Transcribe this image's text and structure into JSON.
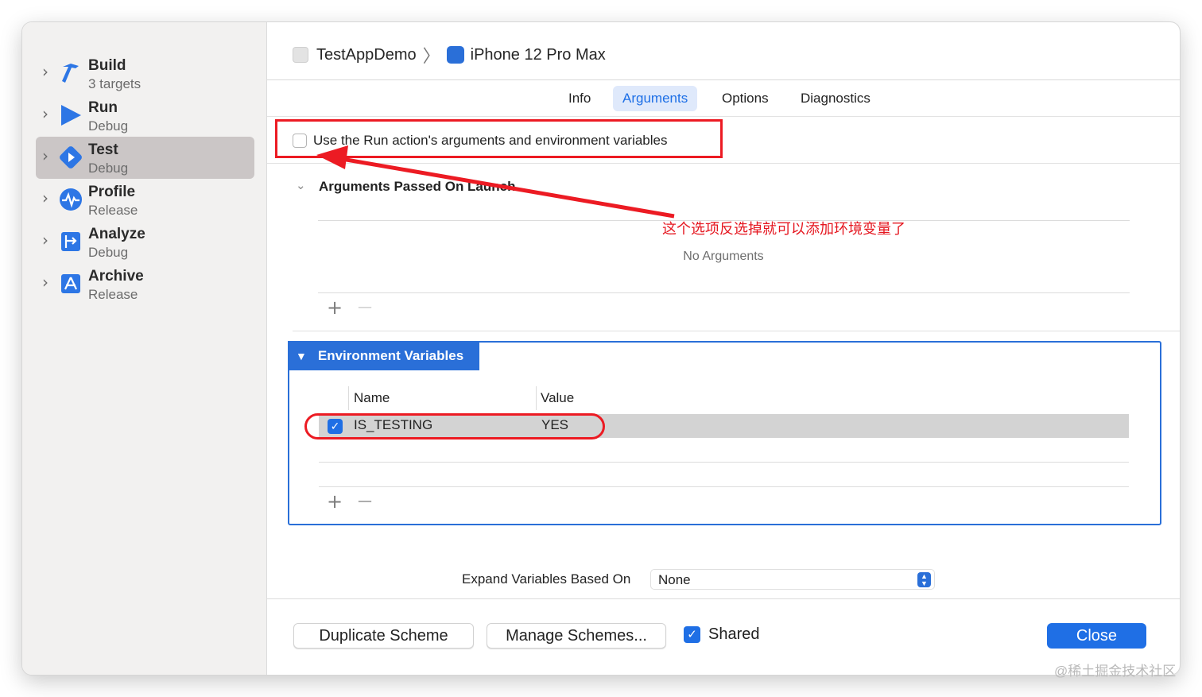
{
  "breadcrumb": {
    "project": "TestAppDemo",
    "separator": "〉",
    "device": "iPhone 12 Pro Max"
  },
  "sidebar": {
    "actions": [
      {
        "name": "Build",
        "sub": "3 targets",
        "icon": "hammer-icon",
        "selected": false
      },
      {
        "name": "Run",
        "sub": "Debug",
        "icon": "play-icon",
        "selected": false
      },
      {
        "name": "Test",
        "sub": "Debug",
        "icon": "test-diamond-icon",
        "selected": true
      },
      {
        "name": "Profile",
        "sub": "Release",
        "icon": "profile-waveform-icon",
        "selected": false
      },
      {
        "name": "Analyze",
        "sub": "Debug",
        "icon": "analyze-icon",
        "selected": false
      },
      {
        "name": "Archive",
        "sub": "Release",
        "icon": "archive-appstore-icon",
        "selected": false
      }
    ]
  },
  "tabs": [
    {
      "label": "Info",
      "active": false
    },
    {
      "label": "Arguments",
      "active": true
    },
    {
      "label": "Options",
      "active": false
    },
    {
      "label": "Diagnostics",
      "active": false
    }
  ],
  "run_action_option": {
    "label": "Use the Run action's arguments and environment variables",
    "checked": false
  },
  "arguments_section": {
    "title": "Arguments Passed On Launch",
    "empty_text": "No Arguments",
    "add": "+",
    "remove": "—"
  },
  "annotation": {
    "text": "这个选项反选掉就可以添加环境变量了",
    "color": "#e5161f"
  },
  "env_section": {
    "title": "Environment Variables",
    "columns": [
      "Name",
      "Value"
    ],
    "rows": [
      {
        "enabled": true,
        "name": "IS_TESTING",
        "value": "YES"
      }
    ],
    "add": "+",
    "remove": "—"
  },
  "expand_variables": {
    "label": "Expand Variables Based On",
    "value": "None"
  },
  "footer": {
    "duplicate": "Duplicate Scheme",
    "manage": "Manage Schemes...",
    "shared_label": "Shared",
    "shared_checked": true,
    "close": "Close"
  },
  "watermark": "@稀土掘金技术社区",
  "colors": {
    "accent": "#1f6fe5",
    "highlight_red": "#ec1b23",
    "sidebar_bg": "#f2f1f0",
    "selected_bg": "#cbc6c6"
  }
}
